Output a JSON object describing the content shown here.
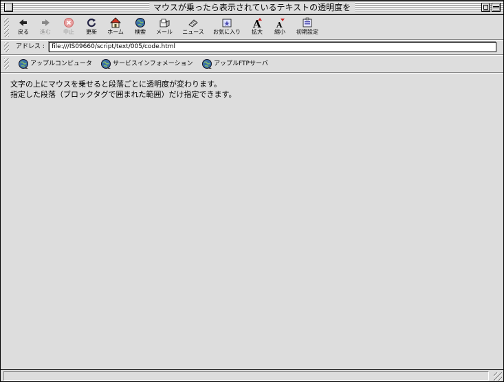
{
  "window": {
    "title": "マウスが乗ったら表示されているテキストの透明度を"
  },
  "toolbar": {
    "buttons": [
      {
        "label": "戻る",
        "icon": "back-arrow-icon",
        "enabled": true
      },
      {
        "label": "進む",
        "icon": "forward-arrow-icon",
        "enabled": false
      },
      {
        "label": "中止",
        "icon": "stop-icon",
        "enabled": false
      },
      {
        "label": "更新",
        "icon": "refresh-icon",
        "enabled": true
      },
      {
        "label": "ホーム",
        "icon": "home-icon",
        "enabled": true
      },
      {
        "label": "検索",
        "icon": "search-globe-icon",
        "enabled": true
      },
      {
        "label": "メール",
        "icon": "mail-icon",
        "enabled": true
      },
      {
        "label": "ニュース",
        "icon": "news-icon",
        "enabled": true
      },
      {
        "label": "お気に入り",
        "icon": "favorites-icon",
        "enabled": true
      },
      {
        "label": "拡大",
        "icon": "text-larger-icon",
        "enabled": true
      },
      {
        "label": "縮小",
        "icon": "text-smaller-icon",
        "enabled": true
      },
      {
        "label": "初期設定",
        "icon": "preferences-icon",
        "enabled": true
      }
    ]
  },
  "address": {
    "label": "アドレス :",
    "value": "file:///IS09660/script/text/005/code.html"
  },
  "favorites": [
    {
      "label": "アップルコンピュータ",
      "icon": "globe-icon"
    },
    {
      "label": "サービスインフォメーション",
      "icon": "globe-icon"
    },
    {
      "label": "アップルFTPサーバ",
      "icon": "globe-icon"
    }
  ],
  "content": {
    "paragraphs": [
      "文字の上にマウスを乗せると段落ごとに透明度が変わります。",
      "指定した段落（ブロックタグで囲まれた範囲）だけ指定できます。"
    ]
  },
  "colors": {
    "chrome": "#dddddd",
    "stop": "#cc3333",
    "home_roof": "#cc3322",
    "globe": "#3a6fa8"
  }
}
